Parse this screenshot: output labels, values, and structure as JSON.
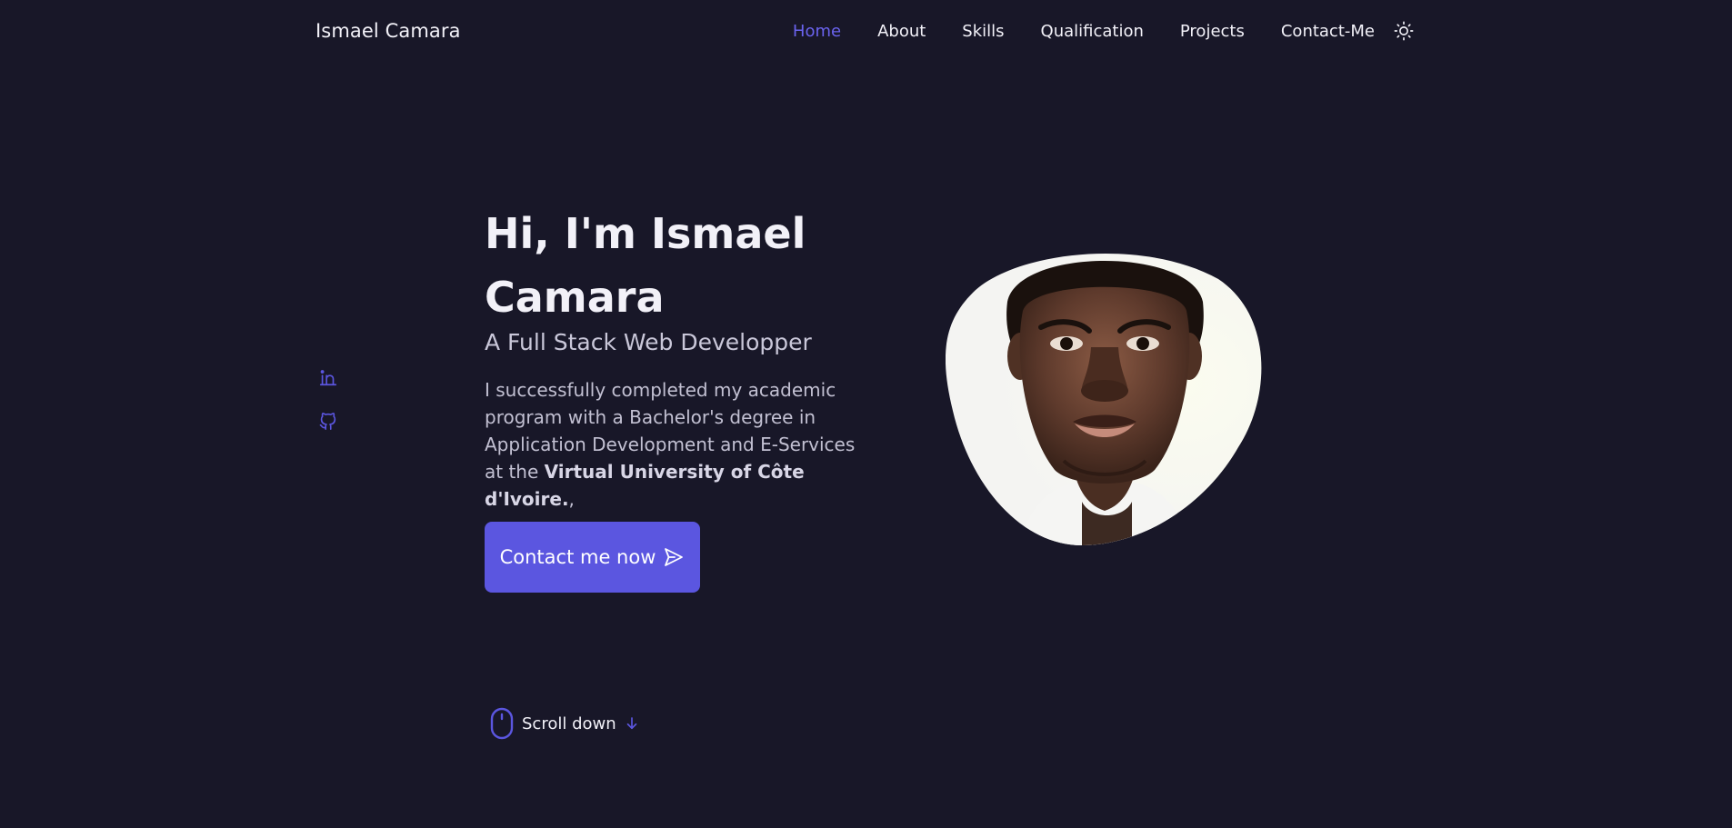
{
  "header": {
    "logo": "Ismael Camara",
    "nav": [
      {
        "label": "Home",
        "active": true
      },
      {
        "label": "About"
      },
      {
        "label": "Skills"
      },
      {
        "label": "Qualification"
      },
      {
        "label": "Projects"
      },
      {
        "label": "Contact-Me"
      }
    ],
    "theme_icon": "sun-icon"
  },
  "social": [
    {
      "icon": "linkedin-icon"
    },
    {
      "icon": "github-icon"
    }
  ],
  "hero": {
    "title": "Hi, I'm Ismael Camara",
    "subtitle": "A Full Stack Web Developper",
    "description_prefix": "I successfully completed my academic program with a Bachelor's degree in Application Development and E-Services at the ",
    "description_bold": "Virtual University of Côte d'Ivoire.",
    "description_suffix": ",",
    "cta_label": "Contact me now",
    "cta_icon": "send-icon"
  },
  "scroll": {
    "label": "Scroll down",
    "mouse_icon": "mouse-icon",
    "arrow_icon": "arrow-down-icon"
  },
  "colors": {
    "background": "#181728",
    "accent": "#5b56e0",
    "accent_text": "#6a63ee",
    "text": "#f2f1f8"
  }
}
